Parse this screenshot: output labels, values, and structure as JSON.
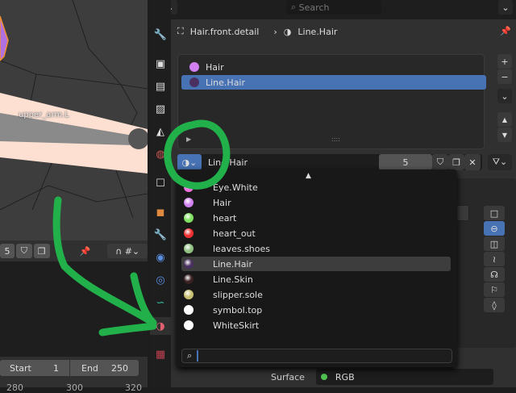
{
  "viewport": {
    "bone_label": "upper_arm.L"
  },
  "viewport_header": {
    "users": "5"
  },
  "timeline": {
    "start_label": "Start",
    "start": "1",
    "end_label": "End",
    "end": "250",
    "ticks": [
      "280",
      "300",
      "320"
    ]
  },
  "topbar": {
    "search_placeholder": "Search"
  },
  "breadcrumb": {
    "object": "Hair.front.detail",
    "material": "Line.Hair"
  },
  "slots": [
    {
      "name": "Hair",
      "color": "#d080f0"
    },
    {
      "name": "Line.Hair",
      "color": "#4a3060"
    }
  ],
  "material_selector": {
    "name": "Line.Hair",
    "users": "5"
  },
  "dropdown": {
    "items": [
      {
        "name": "Eye.White",
        "color": "#f070e0"
      },
      {
        "name": "Hair",
        "color": "#d080f0"
      },
      {
        "name": "heart",
        "color": "#80e060"
      },
      {
        "name": "heart_out",
        "color": "#f03030"
      },
      {
        "name": "leaves.shoes",
        "color": "#90c080"
      },
      {
        "name": "Line.Hair",
        "color": "#4a3060"
      },
      {
        "name": "Line.Skin",
        "color": "#3a2020"
      },
      {
        "name": "slipper.sole",
        "color": "#c8c070"
      },
      {
        "name": "symbol.top",
        "color": "#ffffff"
      },
      {
        "name": "WhiteSkirt",
        "color": "#ffffff"
      }
    ],
    "selected": "Line.Hair",
    "search_value": ""
  },
  "surface": {
    "label": "Surface",
    "value": "RGB",
    "color": "#50c050"
  },
  "accent": "#4772b3",
  "annotation_color": "#22b04a"
}
